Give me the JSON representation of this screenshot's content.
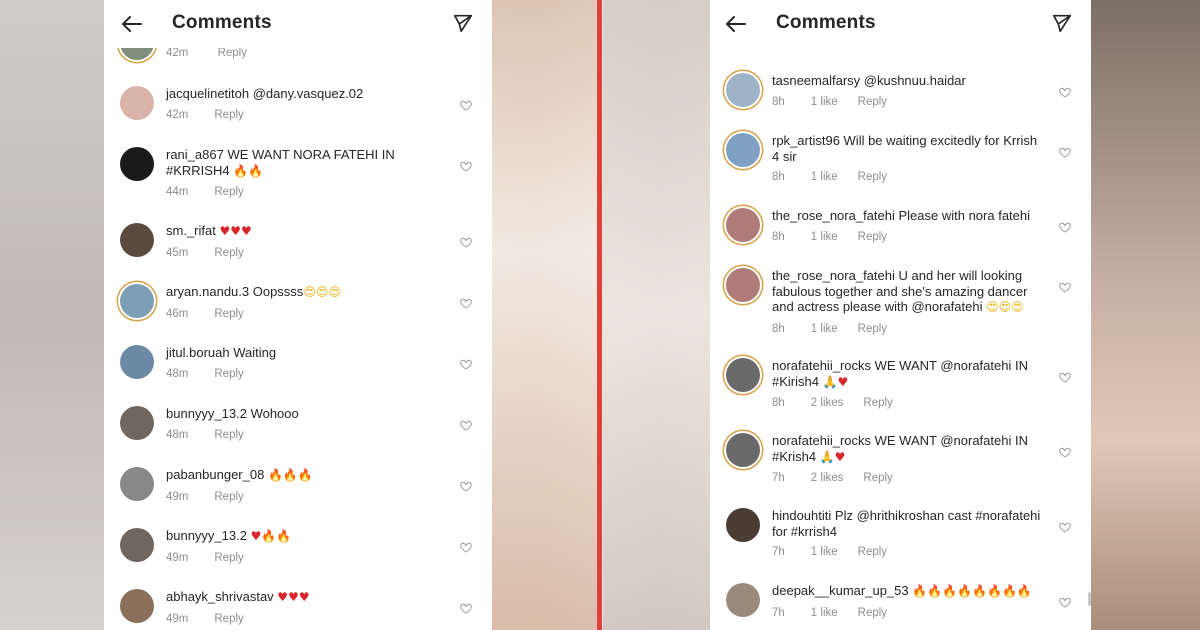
{
  "header": {
    "title": "Comments"
  },
  "left": {
    "partial": {
      "time": "42m",
      "reply": "Reply"
    },
    "comments": [
      {
        "user": "jacquelinetitoh",
        "text": "@dany.vasquez.02",
        "time": "42m",
        "likes": "",
        "reply": "Reply",
        "avatar_color": "#d9b3a8"
      },
      {
        "user": "rani_a867",
        "text": "WE WANT  NORA FATEHI IN #KRRISH4 🔥🔥",
        "time": "44m",
        "likes": "",
        "reply": "Reply",
        "avatar_color": "#1a1a1a"
      },
      {
        "user": "sm._rifat",
        "text": "♥♥♥",
        "time": "45m",
        "likes": "",
        "reply": "Reply",
        "avatar_color": "#5a4a40"
      },
      {
        "user": "aryan.nandu.3",
        "text": "Oopssss😍😍😍",
        "time": "46m",
        "likes": "",
        "reply": "Reply",
        "avatar_color": "#7d9fb5"
      },
      {
        "user": "jitul.boruah",
        "text": "Waiting",
        "time": "48m",
        "likes": "",
        "reply": "Reply",
        "avatar_color": "#6c8aa6"
      },
      {
        "user": "bunnyyy_13.2",
        "text": "Wohooo",
        "time": "48m",
        "likes": "",
        "reply": "Reply",
        "avatar_color": "#6f665f"
      },
      {
        "user": "pabanbunger_08",
        "text": "🔥🔥🔥",
        "time": "49m",
        "likes": "",
        "reply": "Reply",
        "avatar_color": "#888"
      },
      {
        "user": "bunnyyy_13.2",
        "text": "♥🔥🔥",
        "time": "49m",
        "likes": "",
        "reply": "Reply",
        "avatar_color": "#6f665f"
      },
      {
        "user": "abhayk_shrivastav",
        "text": "♥♥♥",
        "time": "49m",
        "likes": "",
        "reply": "Reply",
        "avatar_color": "#8a6f5a"
      }
    ]
  },
  "right": {
    "comments": [
      {
        "user": "tasneemalfarsy",
        "text": "@kushnuu.haidar",
        "time": "8h",
        "likes": "1 like",
        "reply": "Reply",
        "avatar_color": "#9fb3c8"
      },
      {
        "user": "rpk_artist96",
        "text": "Will be waiting excitedly for Krrish 4 sir",
        "time": "8h",
        "likes": "1 like",
        "reply": "Reply",
        "avatar_color": "#7fa0c2"
      },
      {
        "user": "the_rose_nora_fatehi",
        "text": "Please with nora fatehi",
        "time": "8h",
        "likes": "1 like",
        "reply": "Reply",
        "avatar_color": "#b07c7a"
      },
      {
        "user": "the_rose_nora_fatehi",
        "text": "U and her will looking fabulous together and she's amazing dancer and actress please with @norafatehi 😍😍😍",
        "time": "8h",
        "likes": "1 like",
        "reply": "Reply",
        "avatar_color": "#b07c7a"
      },
      {
        "user": "norafatehii_rocks",
        "text": "WE WANT @norafatehi IN #Kirish4 🙏♥",
        "time": "8h",
        "likes": "2 likes",
        "reply": "Reply",
        "avatar_color": "#6a6a6a"
      },
      {
        "user": "norafatehii_rocks",
        "text": "WE WANT @norafatehi IN #Krish4 🙏♥",
        "time": "7h",
        "likes": "2 likes",
        "reply": "Reply",
        "avatar_color": "#6a6a6a"
      },
      {
        "user": "hindouhtiti",
        "text": "Plz @hrithikroshan cast #norafatehi for #krrish4",
        "time": "7h",
        "likes": "1 like",
        "reply": "Reply",
        "avatar_color": "#4a3b33"
      },
      {
        "user": "deepak__kumar_up_53",
        "text": "🔥🔥🔥🔥🔥🔥🔥🔥",
        "time": "7h",
        "likes": "1 like",
        "reply": "Reply",
        "avatar_color": "#9a8a7c"
      }
    ]
  },
  "colors": {
    "divider": "#e0403a",
    "ring": "#d6a34b",
    "text": "#262626",
    "muted": "#8e8e8e"
  },
  "icons": [
    "back-arrow-icon",
    "send-icon",
    "heart-outline-icon"
  ]
}
